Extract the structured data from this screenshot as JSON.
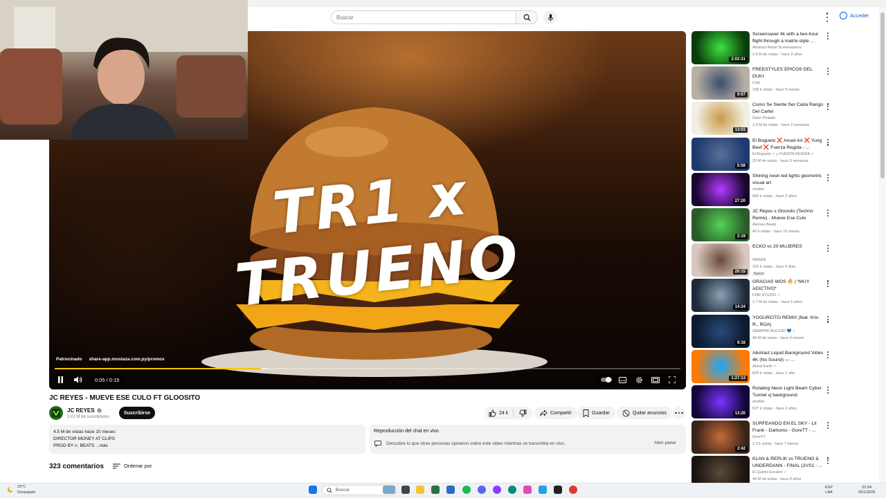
{
  "header": {
    "search_placeholder": "Buscar",
    "sign_in": "Acceder"
  },
  "player": {
    "overlay_text": "TR1 x TRUENO",
    "sponsored_label": "Patrocinado",
    "sponsor_url": "share-app.mostaza.com.py/promos",
    "time": "0:05 / 0:15",
    "progress_fraction": 0.33,
    "buffer_fraction": 0.34
  },
  "video": {
    "title": "JC REYES - MUEVE ESE CULO FT GLOOSITO",
    "channel": "JC REYES",
    "subscribers": "1.01 M de suscriptores",
    "subscribe": "Suscribirse",
    "likes": "24 k",
    "share": "Compartir",
    "save": "Guardar",
    "remove_ads": "Quitar anuncios"
  },
  "description": {
    "meta": "4.5 M de vistas  hace 10 meses",
    "line1": "DIRECTOR MONEY AT CLIPS",
    "line2": "PROD BY rı. BEATS",
    "more": "...más"
  },
  "chat": {
    "title": "Reproducción del chat en vivo",
    "text": "Descubre lo que otras personas opinaron sobre este video mientras se transmitía en vivo.",
    "button": "Abrir panel"
  },
  "comments": {
    "count": "323 comentarios",
    "sort": "Ordenar por"
  },
  "recommendations": [
    {
      "title": "Screensaver 4k with a two-hour flight through a matrix-style ...",
      "channel": "Abstract Relax Screensavers",
      "meta": "2.5 M de vistas · hace 3 años",
      "duration": "2:02:31",
      "colors": [
        "#0a3d0a",
        "#3fe23f"
      ]
    },
    {
      "title": "FREESTYLES EPICOS DEL DUKI",
      "channel": "Cuki",
      "meta": "158 k vistas · hace 5 meses",
      "duration": "9:57",
      "colors": [
        "#b8b0a4",
        "#3b4e6b"
      ]
    },
    {
      "title": "Como Se Siente Ser Cada Rango Del Cartel",
      "channel": "Dolor Pintado",
      "meta": "1.9 M de vistas · hace 2 semanas",
      "duration": "13:03",
      "colors": [
        "#f3efe4",
        "#c89a4a"
      ]
    },
    {
      "title": "El Bogueto ❌ Anuel AA ❌ Yung Beef ❌ Fuerza Regida - ...",
      "channel": "El Bogueto ✓ y FUERZA REGIDA ✓",
      "meta": "29 M de vistas · hace 3 semanas",
      "duration": "5:58",
      "colors": [
        "#1e3a6e",
        "#5a6f96"
      ]
    },
    {
      "title": "Shining neon led lights geometric visual art",
      "channel": "shufilm",
      "meta": "589 k vistas · hace 2 años",
      "duration": "27:20",
      "colors": [
        "#1a0630",
        "#b23cff"
      ]
    },
    {
      "title": "JC Reyes x Gloosito (Techno Remix) - Mueve Ese Culo",
      "channel": "Aleman Beatz",
      "meta": "40 k vistas · hace 10 meses",
      "duration": "2:19",
      "colors": [
        "#2a5c2a",
        "#55d455"
      ]
    },
    {
      "title": "ECKO vs 20 MUJERES",
      "channel": "WANDII",
      "meta": "220 k vistas · hace 5 días",
      "duration": "20:15",
      "badge": "Nuevo",
      "colors": [
        "#d9c8c0",
        "#6b4a3b"
      ]
    },
    {
      "title": "GRACIAS WOS 🔥 | *MUY ADICTIVO*",
      "channel": "FMR STUDIO ✓",
      "meta": "2.7 M de vistas · hace 6 años",
      "duration": "14:24",
      "colors": [
        "#1d2a3a",
        "#88a3b5"
      ]
    },
    {
      "title": "YOGURCITO REMIX (feat. Kris R., ROA)",
      "channel": "SIEMPRE BLESSD 💙 ✓",
      "meta": "48 M de vistas · hace 4 meses",
      "duration": "6:16",
      "colors": [
        "#0b1a2e",
        "#2b4a7a"
      ]
    },
    {
      "title": "Abstract Liquid Background Video 4K (No Sound) — ...",
      "channel": "Astral Earth ✓",
      "meta": "878 k vistas · hace 1 año",
      "duration": "1:27:13",
      "colors": [
        "#ff7a00",
        "#1aa7ff"
      ]
    },
    {
      "title": "Rotating Neon Light Beam Cyber Tunnel vj background",
      "channel": "shufilm",
      "meta": "527 k vistas · hace 2 años",
      "duration": "13:20",
      "colors": [
        "#12063a",
        "#7a35ff"
      ]
    },
    {
      "title": "SURFEANDO EN EL SKY - Lit Frank - Darkoms - GoreTT - ...",
      "channel": "GoreTT",
      "meta": "2.3 k vistas · hace 7 meses",
      "duration": "2:42",
      "colors": [
        "#3a2418",
        "#c86a3a"
      ]
    },
    {
      "title": "KLAN & REPLIK vs TRUENO & UNDERDANN - FINAL (2VS1 - ...",
      "channel": "El Quinto Escalón ✓",
      "meta": "44 M de vistas · hace 8 años",
      "duration": "",
      "colors": [
        "#1a1410",
        "#5a4a3a"
      ]
    }
  ],
  "taskbar": {
    "temperature": "23°C",
    "weather": "Despejado",
    "search": "Buscar",
    "lang1": "ESP",
    "lang2": "LAA",
    "time": "01:04",
    "date": "20/1/2026"
  }
}
